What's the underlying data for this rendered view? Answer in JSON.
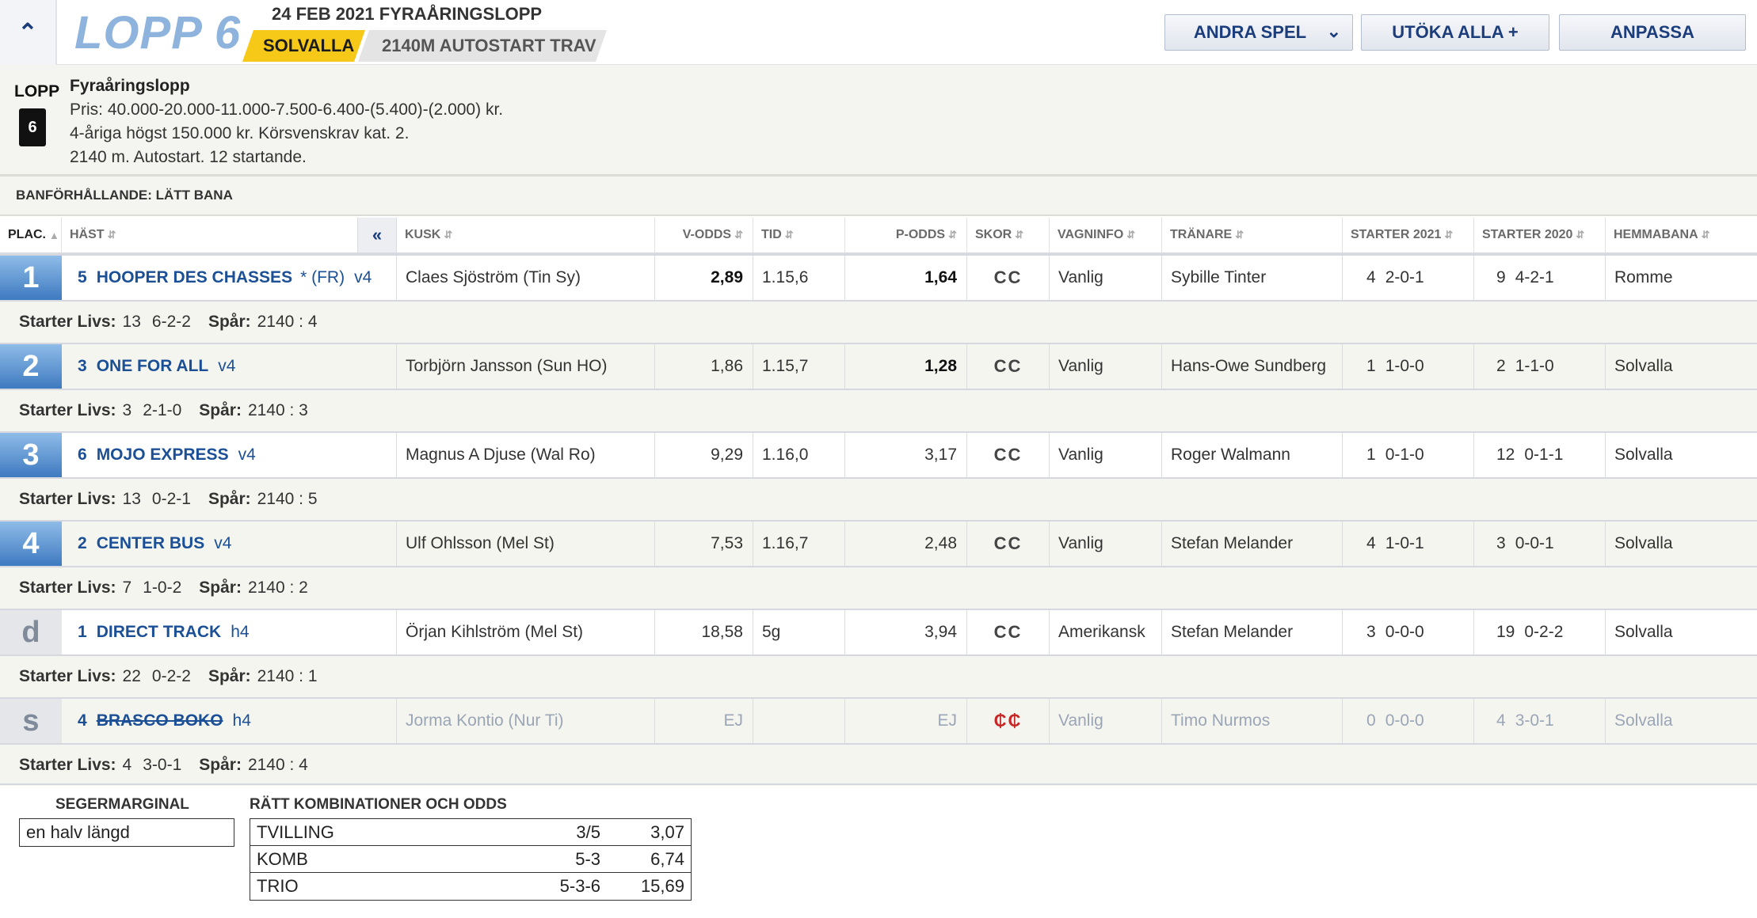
{
  "header": {
    "race_label": "LOPP 6",
    "race_name": "24 FEB 2021 FYRAÅRINGSLOPP",
    "track": "SOLVALLA",
    "distance": "2140M AUTOSTART TRAV",
    "buttons": {
      "andra_spel": "ANDRA SPEL",
      "utoka_alla": "UTÖKA ALLA +",
      "anpassa": "ANPASSA"
    }
  },
  "info": {
    "lopp_label": "LOPP",
    "lopp_number": "6",
    "title": "Fyraåringslopp",
    "lines": [
      "Pris: 40.000-20.000-11.000-7.500-6.400-(5.400)-(2.000) kr.",
      "4-åriga högst 150.000 kr. Körsvenskrav kat. 2.",
      "2140 m. Autostart. 12 startande."
    ]
  },
  "conditions": "BANFÖRHÅLLANDE: LÄTT BANA",
  "columns": {
    "plac": "PLAC.",
    "hast": "HÄST",
    "kusk": "KUSK",
    "v_odds": "V-ODDS",
    "tid": "TID",
    "p_odds": "P-ODDS",
    "skor": "SKOR",
    "vagninfo": "VAGNINFO",
    "tranare": "TRÄNARE",
    "starter_2021": "STARTER 2021",
    "starter_2020": "STARTER 2020",
    "hemmabana": "HEMMABANA",
    "collapse": "«"
  },
  "rows": [
    {
      "plac": "1",
      "num": "5",
      "name": "HOOPER DES CHASSES",
      "extra": "* (FR)",
      "age": "v4",
      "kusk": "Claes Sjöström (Tin Sy)",
      "v_odds": "2,89",
      "tid": "1.15,6",
      "p_odds": "1,64",
      "skor": "CC",
      "vagn": "Vanlig",
      "tranare": "Sybille Tinter",
      "s21": "4",
      "s21r": "2-0-1",
      "s20": "9",
      "s20r": "4-2-1",
      "hem": "Romme",
      "livs": "13",
      "livs_r": "6-2-2",
      "spar": "2140 : 4"
    },
    {
      "plac": "2",
      "num": "3",
      "name": "ONE FOR ALL",
      "extra": "",
      "age": "v4",
      "kusk": "Torbjörn Jansson (Sun HO)",
      "v_odds": "1,86",
      "tid": "1.15,7",
      "p_odds": "1,28",
      "skor": "CC",
      "vagn": "Vanlig",
      "tranare": "Hans-Owe Sundberg",
      "s21": "1",
      "s21r": "1-0-0",
      "s20": "2",
      "s20r": "1-1-0",
      "hem": "Solvalla",
      "livs": "3",
      "livs_r": "2-1-0",
      "spar": "2140 : 3"
    },
    {
      "plac": "3",
      "num": "6",
      "name": "MOJO EXPRESS",
      "extra": "",
      "age": "v4",
      "kusk": "Magnus A Djuse (Wal Ro)",
      "v_odds": "9,29",
      "tid": "1.16,0",
      "p_odds": "3,17",
      "skor": "CC",
      "vagn": "Vanlig",
      "tranare": "Roger Walmann",
      "s21": "1",
      "s21r": "0-1-0",
      "s20": "12",
      "s20r": "0-1-1",
      "hem": "Solvalla",
      "livs": "13",
      "livs_r": "0-2-1",
      "spar": "2140 : 5"
    },
    {
      "plac": "4",
      "num": "2",
      "name": "CENTER BUS",
      "extra": "",
      "age": "v4",
      "kusk": "Ulf Ohlsson (Mel St)",
      "v_odds": "7,53",
      "tid": "1.16,7",
      "p_odds": "2,48",
      "skor": "CC",
      "vagn": "Vanlig",
      "tranare": "Stefan Melander",
      "s21": "4",
      "s21r": "1-0-1",
      "s20": "3",
      "s20r": "0-0-1",
      "hem": "Solvalla",
      "livs": "7",
      "livs_r": "1-0-2",
      "spar": "2140 : 2"
    },
    {
      "plac": "d",
      "num": "1",
      "name": "DIRECT TRACK",
      "extra": "",
      "age": "h4",
      "kusk": "Örjan Kihlström (Mel St)",
      "v_odds": "18,58",
      "tid": "5g",
      "p_odds": "3,94",
      "skor": "CC",
      "vagn": "Amerikansk",
      "tranare": "Stefan Melander",
      "s21": "3",
      "s21r": "0-0-0",
      "s20": "19",
      "s20r": "0-2-2",
      "hem": "Solvalla",
      "livs": "22",
      "livs_r": "0-2-2",
      "spar": "2140 : 1"
    },
    {
      "plac": "s",
      "num": "4",
      "name": "BRASCO BOKO",
      "extra": "",
      "age": "h4",
      "kusk": "Jorma Kontio (Nur Ti)",
      "v_odds": "EJ",
      "tid": "",
      "p_odds": "EJ",
      "skor": "₵₵",
      "vagn": "Vanlig",
      "tranare": "Timo Nurmos",
      "s21": "0",
      "s21r": "0-0-0",
      "s20": "4",
      "s20r": "3-0-1",
      "hem": "Solvalla",
      "livs": "4",
      "livs_r": "3-0-1",
      "spar": "2140 : 4"
    }
  ],
  "labels": {
    "starter_livs": "Starter Livs:",
    "spar": "Spår:"
  },
  "result": {
    "seg_head": "SEGERMARGINAL",
    "seg_value": "en halv längd",
    "combo_head": "RÄTT KOMBINATIONER OCH ODDS",
    "combos": [
      {
        "k": "TVILLING",
        "c": "3/5",
        "o": "3,07"
      },
      {
        "k": "KOMB",
        "c": "5-3",
        "o": "6,74"
      },
      {
        "k": "TRIO",
        "c": "5-3-6",
        "o": "15,69"
      }
    ]
  },
  "colors": {
    "accent": "#1b4f96",
    "track_badge": "#f6c818",
    "place_gradient_top": "#8fbce8",
    "place_gradient_bottom": "#3e7ac0",
    "scratched_shoes": "#c62828"
  }
}
